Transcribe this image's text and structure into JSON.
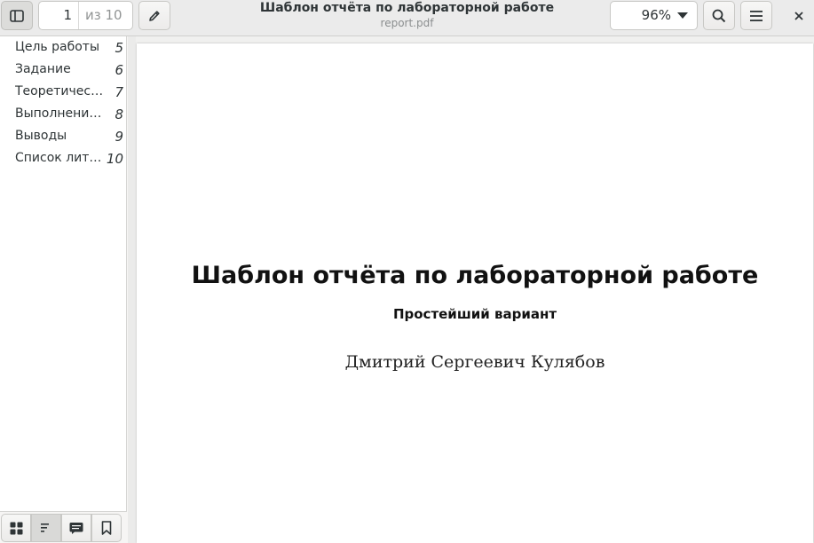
{
  "header": {
    "title": "Шаблон отчёта по лабораторной работе",
    "subtitle": "report.pdf",
    "page_current": "1",
    "page_total_label": "из 10",
    "zoom": "96%"
  },
  "icons": {
    "sidebar_toggle": "sidebar-toggle-icon",
    "annotate": "pencil-icon",
    "zoom_dropdown": "chevron-down-icon",
    "search": "search-icon",
    "menu": "hamburger-menu-icon",
    "close": "close-icon",
    "thumbnails": "grid-icon",
    "outline": "list-icon",
    "annotations": "comment-icon",
    "bookmarks": "bookmark-icon"
  },
  "sidebar": {
    "outline": [
      {
        "label": "Цель работы",
        "page": "5"
      },
      {
        "label": "Задание",
        "page": "6"
      },
      {
        "label": "Теоретичес…",
        "page": "7"
      },
      {
        "label": "Выполнение…",
        "page": "8"
      },
      {
        "label": "Выводы",
        "page": "9"
      },
      {
        "label": "Список лите…",
        "page": "10"
      }
    ],
    "active_tab": "outline"
  },
  "document": {
    "title": "Шаблон отчёта по лабораторной работе",
    "subtitle": "Простейший вариант",
    "author": "Дмитрий Сергеевич Кулябов"
  }
}
